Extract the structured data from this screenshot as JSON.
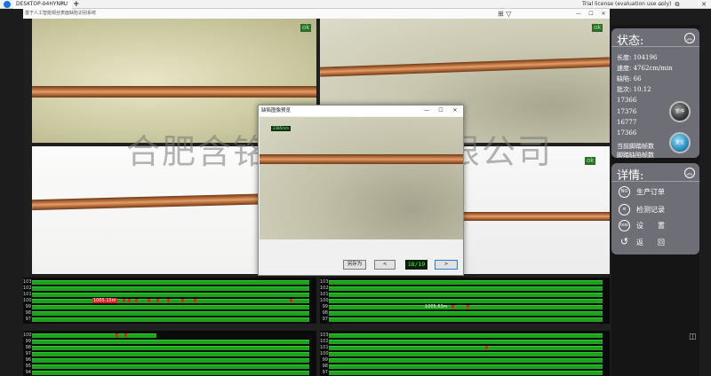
{
  "remote_bar": {
    "tab_label": "DESKTOP-04HYNPU",
    "tab_close": "×",
    "new_tab": "+",
    "trial_text": "Trial license (evaluation use only)",
    "ctrl_min": "—",
    "ctrl_max": "▭",
    "ctrl_restore": "⧉",
    "ctrl_close": "✕"
  },
  "app": {
    "title": "基于人工智能铜丝表面缺陷识别系统",
    "ctrl_min": "—",
    "ctrl_max": "☐",
    "ctrl_close": "✕",
    "icons": "⊞ ▽"
  },
  "cameras": [
    {
      "ok": "ok"
    },
    {
      "ok": "ok"
    },
    {
      "ok": ""
    },
    {
      "ok": "ok"
    }
  ],
  "watermark": "合肥含铭电子技术有限公司",
  "charts": {
    "top_left": {
      "rows": [
        "103",
        "102",
        "101",
        "100",
        "99",
        "98",
        "97"
      ],
      "tag": "1005.15m"
    },
    "top_right": {
      "rows": [
        "103",
        "102",
        "101",
        "100",
        "99",
        "98",
        "97"
      ],
      "tag": "1005.63m"
    },
    "bottom_left": {
      "rows": [
        "100",
        "99",
        "98",
        "97",
        "96",
        "95",
        "94"
      ]
    },
    "bottom_right": {
      "rows": [
        "103",
        "102",
        "101",
        "100",
        "99",
        "98",
        "97"
      ]
    }
  },
  "dialog": {
    "title": "缺陷图像预览",
    "badge": "2385mm",
    "save_label": "另存为",
    "prev_label": "<",
    "counter": "18/19",
    "next_label": ">",
    "ctrl_min": "—",
    "ctrl_max": "☐",
    "ctrl_close": "✕"
  },
  "status": {
    "heading": "状态:",
    "collapse": "︽",
    "length": "长度: 104196",
    "speed": "速度: 4762cm/min",
    "defects": "缺陷: 66",
    "batch": "批次: 10.12",
    "frame1": "17366",
    "frame2": "17376",
    "frame3": "16777",
    "frame4": "17366",
    "frame_label1": "当前脚踏帧数",
    "frame_label2": "脚踏缺陷帧数",
    "btn_pause": "暂停",
    "btn_reset": "复位"
  },
  "details": {
    "heading": "详情:",
    "collapse": "︽",
    "items": [
      {
        "icon": "NO",
        "label": "生产订单"
      },
      {
        "icon": "≡",
        "label": "检测记录"
      },
      {
        "icon": "ooo",
        "label": "设　　置"
      },
      {
        "icon": "↺",
        "label": "返　　回"
      }
    ]
  },
  "colors": {
    "bar_green": "#1fa01f",
    "defect_red": "#e12020",
    "panel_gray": "#6e6e76",
    "counter_green": "#33ff33"
  }
}
